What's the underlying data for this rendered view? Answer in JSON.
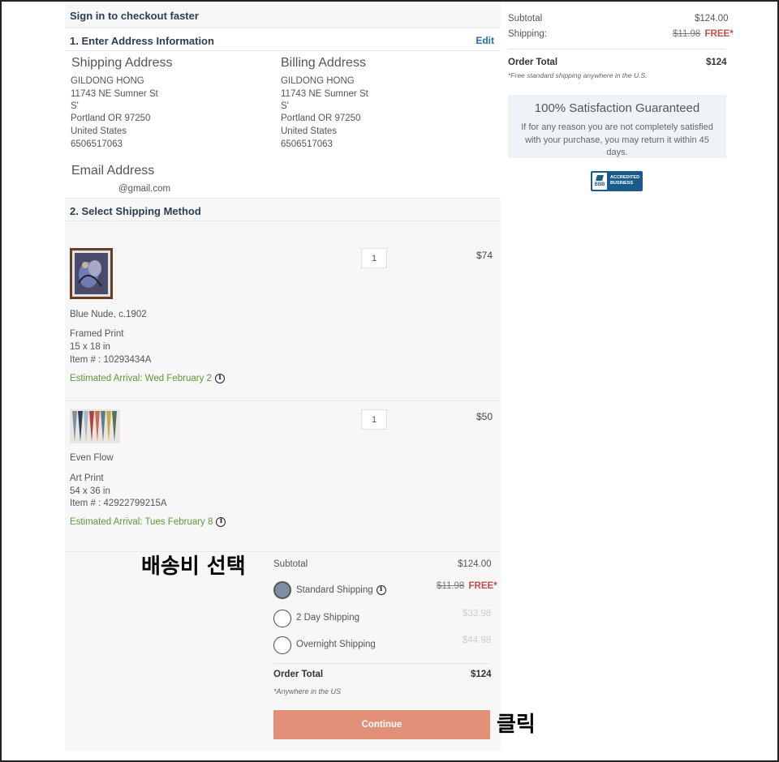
{
  "left": {
    "signin_banner": "Sign in to checkout faster",
    "step1": {
      "title": "1. Enter Address Information",
      "edit_label": "Edit"
    },
    "shipping_address": {
      "title": "Shipping Address",
      "lines": [
        "GILDONG HONG",
        "11743 NE Sumner St",
        "S'",
        "Portland OR 97250",
        "United States",
        "6506517063"
      ]
    },
    "billing_address": {
      "title": "Billing Address",
      "lines": [
        "GILDONG HONG",
        "11743 NE Sumner St",
        "S'",
        "Portland OR 97250",
        "United States",
        "6506517063"
      ]
    },
    "email": {
      "title": "Email Address",
      "value": "@gmail.com"
    },
    "step2": {
      "title": "2. Select Shipping Method"
    },
    "items": [
      {
        "name": "Blue Nude, c.1902",
        "type": "Framed Print",
        "size": "15 x 18 in",
        "item_no": "Item # : 10293434A",
        "arrival": "Estimated Arrival: Wed February 2",
        "qty": "1",
        "price": "$74"
      },
      {
        "name": "Even Flow",
        "type": "Art Print",
        "size": "54 x 36 in",
        "item_no": "Item # : 42922799215A",
        "arrival": "Estimated Arrival: Tues February 8",
        "qty": "1",
        "price": "$50"
      }
    ],
    "shipping_summary": {
      "subtotal_label": "Subtotal",
      "subtotal_value": "$124.00",
      "options": [
        {
          "label": "Standard Shipping",
          "old_price": "$11.98",
          "price": "FREE*",
          "selected": true
        },
        {
          "label": "2 Day Shipping",
          "price": "$33.98",
          "selected": false
        },
        {
          "label": "Overnight Shipping",
          "price": "$44.98",
          "selected": false
        }
      ],
      "order_total_label": "Order Total",
      "order_total_value": "$124",
      "note": "*Anywhere in the US"
    },
    "continue_label": "Continue"
  },
  "right": {
    "subtotal_label": "Subtotal",
    "subtotal_value": "$124.00",
    "shipping_label": "Shipping:",
    "shipping_old": "$11.98",
    "shipping_value": "FREE*",
    "order_total_label": "Order Total",
    "order_total_value": "$124",
    "free_note": "*Free standard shipping anywhere in the U.S.",
    "guarantee_title": "100% Satisfaction Guaranteed",
    "guarantee_text_1": "If for any reason you are not completely satisfied",
    "guarantee_text_2": "with your purchase, you may return it within 45",
    "guarantee_text_3": "days.",
    "bbb_line1": "ACCREDITED",
    "bbb_line2": "BUSINESS",
    "bbb_logo": "BBB"
  },
  "annotations": {
    "select_shipping": "배송비 선택",
    "click": "클릭"
  }
}
